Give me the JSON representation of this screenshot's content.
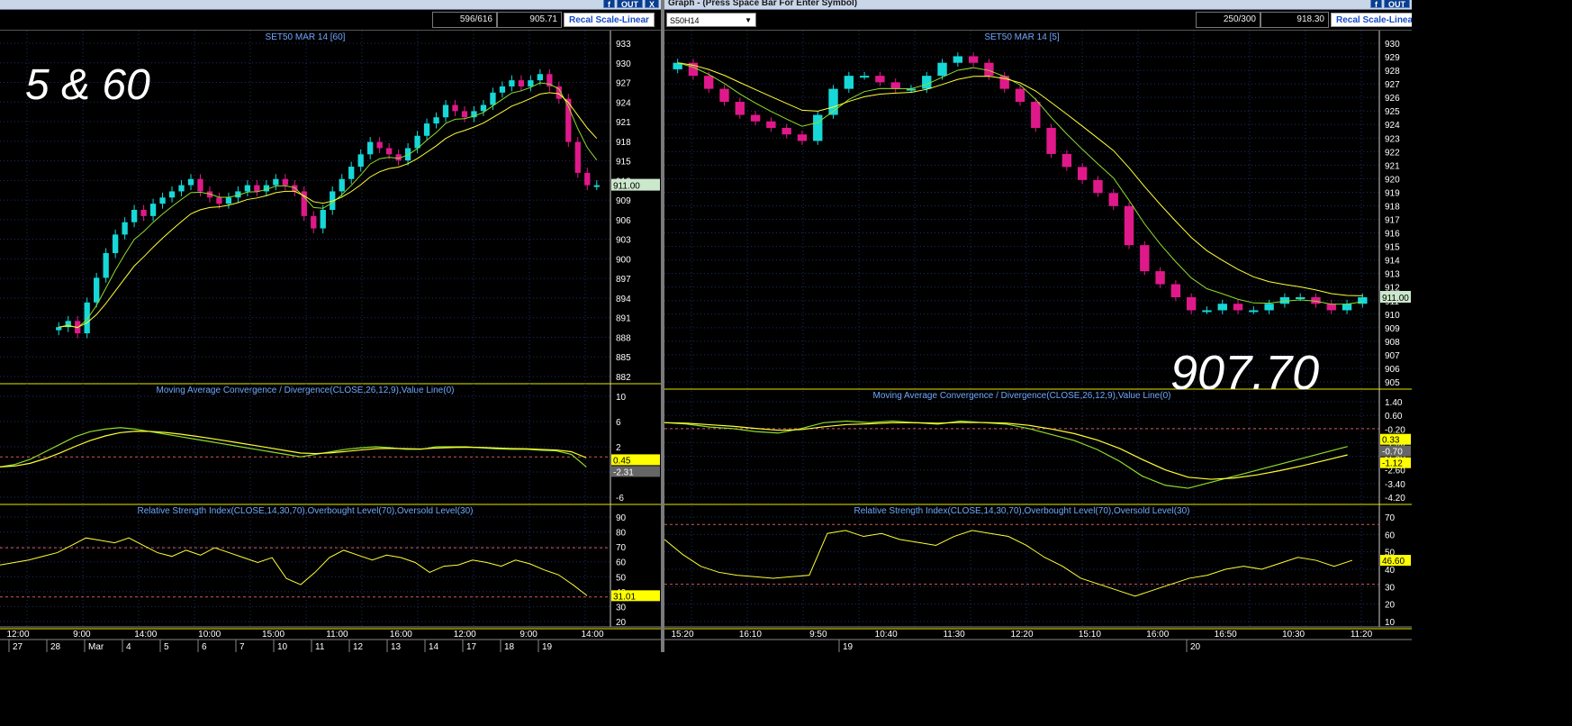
{
  "left": {
    "window_buttons": [
      "f",
      "OUT",
      "X"
    ],
    "toolbar": {
      "counter": "596/616",
      "last": "905.71",
      "recal_label": "Recal Scale-Linear"
    },
    "overlay_label": "5 & 60",
    "price_panel": {
      "title": "SET50 MAR 14  [60]",
      "ticks": [
        "933",
        "930",
        "927",
        "924",
        "921",
        "918",
        "915",
        "912",
        "909",
        "906",
        "903",
        "900",
        "897",
        "894",
        "891",
        "888",
        "885",
        "882"
      ],
      "last_tag": "911.00"
    },
    "macd_panel": {
      "title": "Moving Average Convergence / Divergence(CLOSE,26,12,9),Value Line(0)",
      "ticks": [
        "10",
        "6",
        "2",
        "-2",
        "-6"
      ],
      "tag1": "0.45",
      "tag2": "-2.31"
    },
    "rsi_panel": {
      "title": "Relative Strength Index(CLOSE,14,30,70),Overbought Level(70),Oversold Level(30)",
      "ticks": [
        "90",
        "80",
        "70",
        "60",
        "50",
        "40",
        "30",
        "20"
      ],
      "tag": "31.01"
    },
    "time_labels": [
      "12:00",
      "9:00",
      "14:00",
      "10:00",
      "15:00",
      "11:00",
      "16:00",
      "12:00",
      "9:00",
      "14:00"
    ],
    "date_labels": [
      "27",
      "28",
      "Mar",
      "4",
      "5",
      "6",
      "7",
      "10",
      "11",
      "12",
      "13",
      "14",
      "17",
      "18",
      "19"
    ]
  },
  "right": {
    "window_title": "Graph  - (Press Space Bar For Enter Symbol)",
    "window_buttons": [
      "f",
      "OUT"
    ],
    "toolbar": {
      "symbol": "S50H14",
      "counter": "250/300",
      "last": "918.30",
      "recal_label": "Recal Scale-Linear"
    },
    "overlay_label": "907.70",
    "price_panel": {
      "title": "SET50 MAR 14  [5]",
      "ticks": [
        "930",
        "929",
        "928",
        "927",
        "926",
        "925",
        "924",
        "923",
        "922",
        "921",
        "920",
        "919",
        "918",
        "917",
        "916",
        "915",
        "914",
        "913",
        "912",
        "911",
        "910",
        "909",
        "908",
        "907",
        "906",
        "905"
      ],
      "last_tag": "911.00"
    },
    "macd_panel": {
      "title": "Moving Average Convergence / Divergence(CLOSE,26,12,9),Value Line(0)",
      "ticks": [
        "1.40",
        "0.60",
        "-0.20",
        "-1.00",
        "-1.80",
        "-2.60",
        "-3.40",
        "-4.20"
      ],
      "tag1": "0.33",
      "tag2": "-0.70",
      "tag3": "-1.12"
    },
    "rsi_panel": {
      "title": "Relative Strength Index(CLOSE,14,30,70),Overbought Level(70),Oversold Level(30)",
      "ticks": [
        "70",
        "60",
        "50",
        "40",
        "30",
        "20",
        "10"
      ],
      "tag": "46.60"
    },
    "time_labels": [
      "15:20",
      "16:10",
      "9:50",
      "10:40",
      "11:30",
      "12:20",
      "15:10",
      "16:00",
      "16:50",
      "10:30",
      "11:20"
    ],
    "date_labels": [
      "19",
      "20"
    ]
  },
  "colors": {
    "up": "#17d8d8",
    "down": "#e0198a",
    "ma_fast": "#ffff33",
    "ma_slow": "#8fdc2a",
    "grid": "#1e2e66",
    "level": "#d05a5a",
    "axis_text": "#ffffff",
    "title_text": "#6fa8ff",
    "tag_bg": "#ffff00",
    "tag_price_bg": "#cce8cc"
  },
  "chart_data": [
    {
      "type": "candlestick",
      "title": "SET50 MAR 14  [60]",
      "panels": [
        "price",
        "macd",
        "rsi"
      ],
      "price_ylim": [
        880,
        934
      ],
      "price_close_series": [
        888,
        889,
        887,
        892,
        896,
        900,
        903,
        905,
        907,
        906,
        908,
        909,
        910,
        911,
        912,
        910,
        909,
        908,
        909,
        910,
        911,
        910,
        911,
        912,
        911,
        910,
        906,
        904,
        907,
        910,
        912,
        914,
        916,
        918,
        917,
        916,
        915,
        917,
        919,
        921,
        922,
        924,
        923,
        922,
        923,
        924,
        926,
        927,
        928,
        927,
        928,
        929,
        927,
        925,
        918,
        913,
        911,
        911
      ],
      "macd_ylim": [
        -8,
        12
      ],
      "macd_series": [
        -2,
        -1.5,
        -0.5,
        1,
        2.5,
        4,
        5,
        5.5,
        5.8,
        5.5,
        5,
        4.5,
        4,
        3.5,
        3,
        2.5,
        2,
        1.5,
        1,
        0.5,
        0,
        0.5,
        1,
        1.5,
        1.8,
        2,
        1.8,
        1.5,
        1.5,
        2,
        2,
        2,
        1.8,
        1.6,
        1.5,
        1.5,
        1.3,
        1.2,
        0.5,
        -2
      ],
      "rsi_ylim": [
        10,
        95
      ],
      "rsi_series": [
        56,
        58,
        60,
        63,
        66,
        72,
        78,
        76,
        74,
        78,
        72,
        66,
        63,
        68,
        64,
        70,
        66,
        62,
        58,
        62,
        45,
        40,
        50,
        62,
        68,
        64,
        60,
        64,
        62,
        58,
        50,
        55,
        56,
        60,
        58,
        55,
        60,
        57,
        52,
        48,
        40,
        31
      ]
    },
    {
      "type": "candlestick",
      "title": "SET50 MAR 14  [5]",
      "panels": [
        "price",
        "macd",
        "rsi"
      ],
      "price_ylim": [
        904.5,
        930.5
      ],
      "price_close_series": [
        929,
        928,
        927,
        926,
        925,
        924.5,
        924,
        923.5,
        923,
        925,
        927,
        928,
        928,
        927.5,
        927,
        927,
        928,
        929,
        929.5,
        929,
        928,
        927,
        926,
        924,
        922,
        921,
        920,
        919,
        918,
        915,
        913,
        912,
        911,
        910,
        910,
        910.5,
        910,
        910,
        910.5,
        911,
        911,
        910.5,
        910,
        910.5,
        911
      ],
      "macd_ylim": [
        -4.6,
        1.8
      ],
      "macd_series": [
        0.4,
        0.3,
        0.1,
        0,
        -0.2,
        -0.3,
        0,
        0.4,
        0.5,
        0.4,
        0.5,
        0.4,
        0.3,
        0.5,
        0.4,
        0.3,
        0,
        -0.4,
        -0.8,
        -1.4,
        -2.2,
        -3.2,
        -3.8,
        -4,
        -3.6,
        -3.2,
        -2.8,
        -2.4,
        -2,
        -1.6,
        -1.2
      ],
      "rsi_ylim": [
        5,
        75
      ],
      "rsi_series": [
        60,
        50,
        42,
        38,
        36,
        35,
        34,
        35,
        36,
        64,
        66,
        62,
        64,
        60,
        58,
        56,
        62,
        66,
        64,
        62,
        56,
        48,
        42,
        34,
        30,
        26,
        22,
        26,
        30,
        34,
        36,
        40,
        42,
        40,
        44,
        48,
        46,
        42,
        46
      ],
      "overbought": 70,
      "oversold": 30
    }
  ]
}
